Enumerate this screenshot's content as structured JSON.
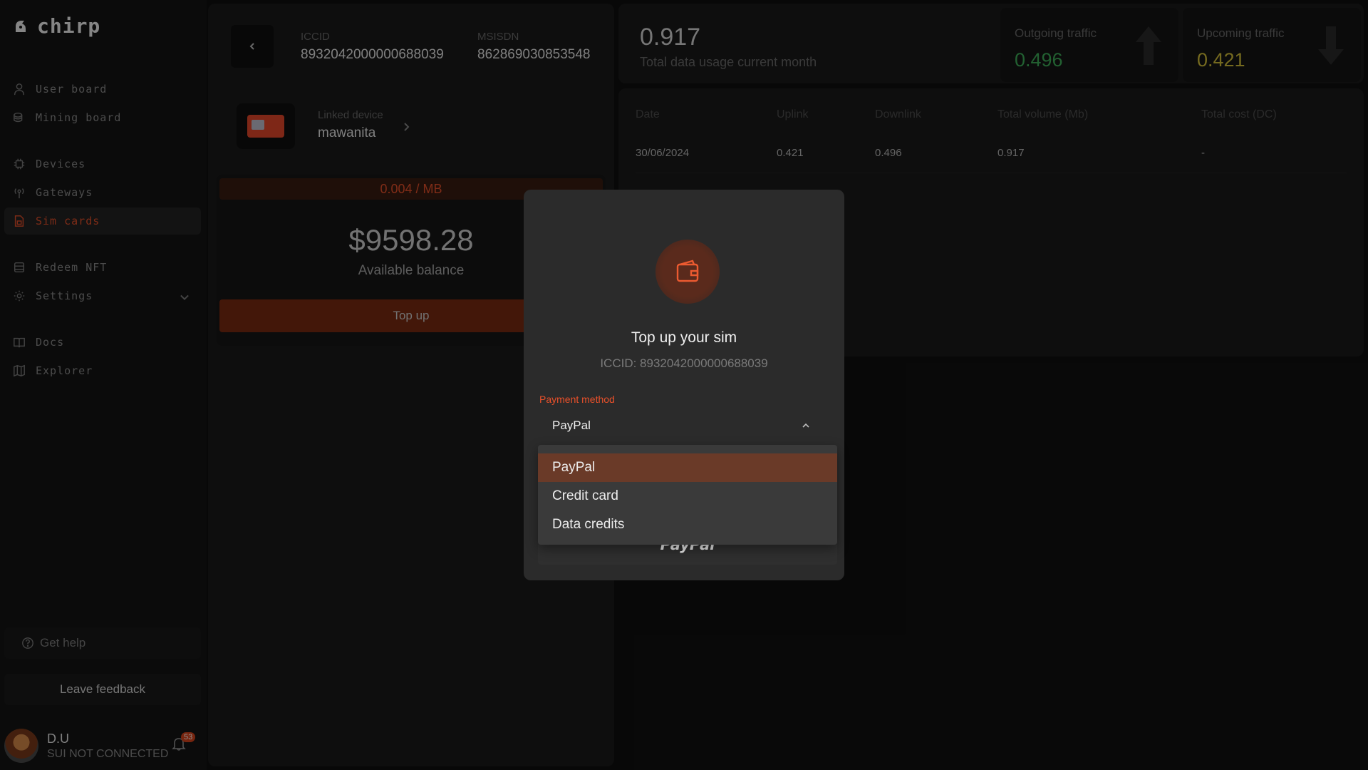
{
  "app": {
    "logo_text": "chirp"
  },
  "sidebar": {
    "items": [
      {
        "label": "User board"
      },
      {
        "label": "Mining board"
      },
      {
        "label": "Devices"
      },
      {
        "label": "Gateways"
      },
      {
        "label": "Sim cards"
      },
      {
        "label": "Redeem NFT"
      },
      {
        "label": "Settings"
      },
      {
        "label": "Docs"
      },
      {
        "label": "Explorer"
      }
    ],
    "active_item": "Sim cards",
    "help_label": "Get help",
    "feedback_label": "Leave feedback",
    "user": {
      "name": "D.U",
      "status": "SUI NOT CONNECTED",
      "notification_count": "53"
    }
  },
  "sim": {
    "iccid_label": "ICCID",
    "iccid": "8932042000000688039",
    "msisdn_label": "MSISDN",
    "msisdn": "862869030853548",
    "linked_device_label": "Linked device",
    "linked_device": "mawanita",
    "price": "0.004 / MB",
    "balance": "$9598.28",
    "balance_label": "Available balance",
    "topup_label": "Top up"
  },
  "stats": {
    "total": "0.917",
    "total_label": "Total data usage current month",
    "outgoing_label": "Outgoing traffic",
    "outgoing_value": "0.496",
    "upcoming_label": "Upcoming traffic",
    "upcoming_value": "0.421",
    "outgoing_color": "#3fb05a",
    "upcoming_color": "#d6c23a"
  },
  "table": {
    "headers": [
      "Date",
      "Uplink",
      "Downlink",
      "Total volume (Mb)",
      "Total cost (DC)"
    ],
    "rows": [
      [
        "30/06/2024",
        "0.421",
        "0.496",
        "0.917",
        "-"
      ]
    ]
  },
  "modal": {
    "title": "Top up your sim",
    "subtitle": "ICCID: 8932042000000688039",
    "payment_label": "Payment method",
    "selected_method": "PayPal",
    "options": [
      "PayPal",
      "Credit card",
      "Data credits"
    ],
    "paypal_button": "PayPal"
  },
  "colors": {
    "accent": "#e8502a",
    "background": "#101010"
  }
}
